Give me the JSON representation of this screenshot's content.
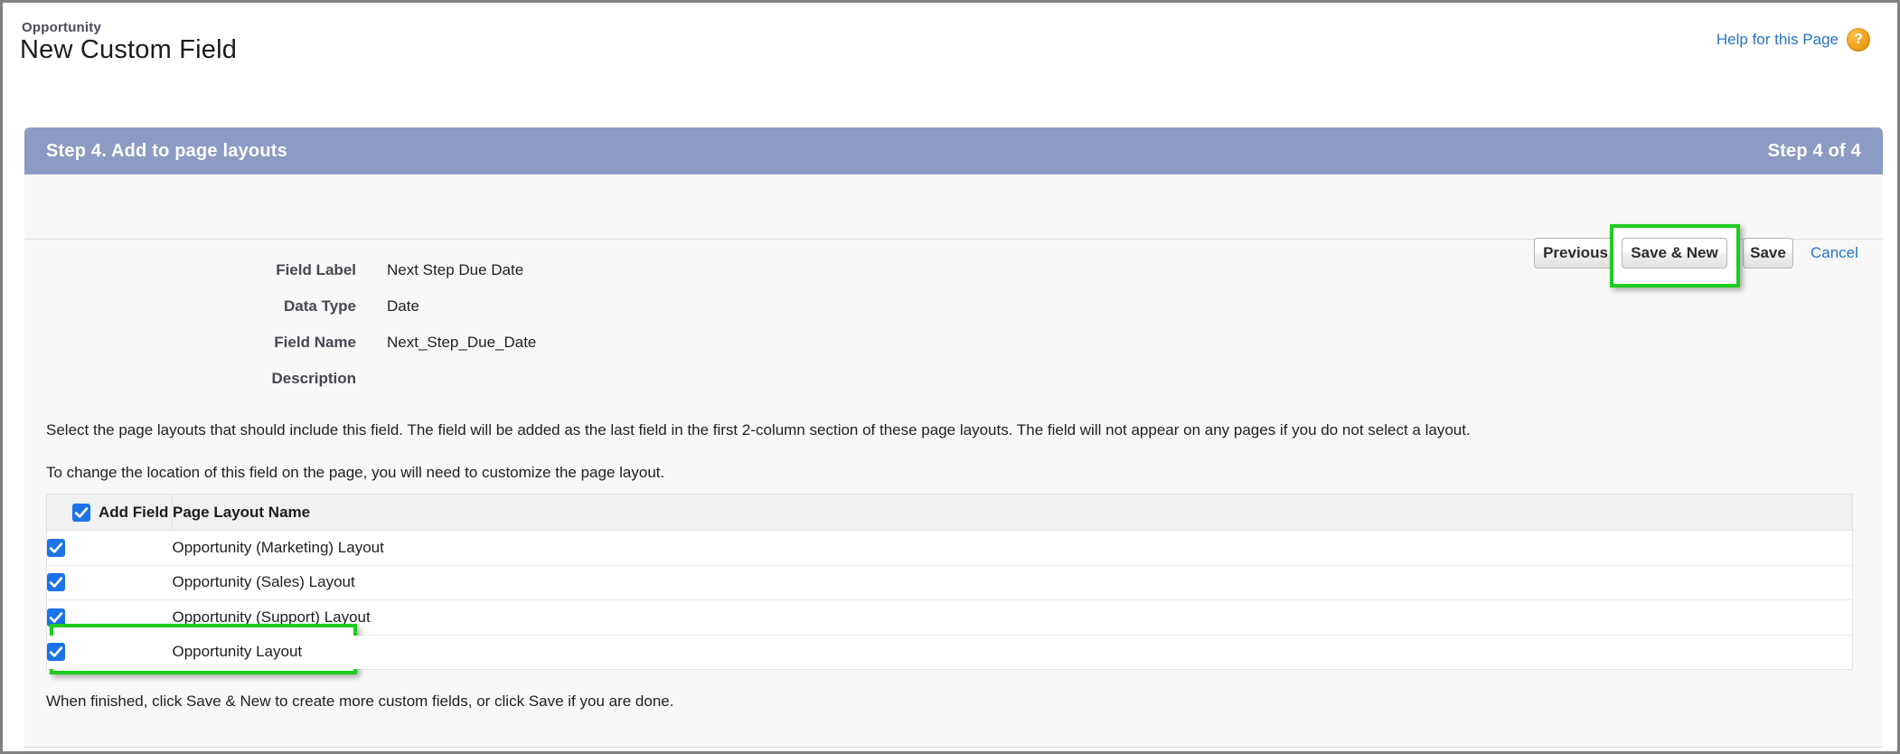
{
  "header": {
    "breadcrumb": "Opportunity",
    "title": "New Custom Field",
    "help_label": "Help for this Page",
    "help_icon_glyph": "?"
  },
  "panel": {
    "step_title": "Step 4. Add to page layouts",
    "step_counter": "Step 4 of 4",
    "buttons": {
      "previous": "Previous",
      "save_new": "Save & New",
      "save": "Save",
      "cancel": "Cancel"
    },
    "fields": [
      {
        "label": "Field Label",
        "value": "Next Step Due Date"
      },
      {
        "label": "Data Type",
        "value": "Date"
      },
      {
        "label": "Field Name",
        "value": "Next_Step_Due_Date"
      },
      {
        "label": "Description",
        "value": ""
      }
    ],
    "instructions": [
      "Select the page layouts that should include this field. The field will be added as the last field in the first 2-column section of these page layouts. The field will not appear on any pages if you do not select a layout.",
      "To change the location of this field on the page, you will need to customize the page layout."
    ],
    "table": {
      "headers": {
        "add_field": "Add Field",
        "layout_name": "Page Layout Name"
      },
      "select_all_checked": true,
      "rows": [
        {
          "checked": true,
          "name": "Opportunity (Marketing) Layout"
        },
        {
          "checked": true,
          "name": "Opportunity (Sales) Layout"
        },
        {
          "checked": true,
          "name": "Opportunity (Support) Layout"
        },
        {
          "checked": true,
          "name": "Opportunity Layout"
        }
      ]
    },
    "footer_note": "When finished, click Save & New to create more custom fields, or click Save if you are done."
  },
  "colors": {
    "step_header_bg": "#8b9bc4",
    "link": "#2573c4",
    "checkbox": "#1a73e8",
    "highlight": "#1ecb1e",
    "help_icon": "#f0a21c",
    "panel_bg": "#f8f8f8",
    "table_header_bg": "#eff1f2"
  }
}
